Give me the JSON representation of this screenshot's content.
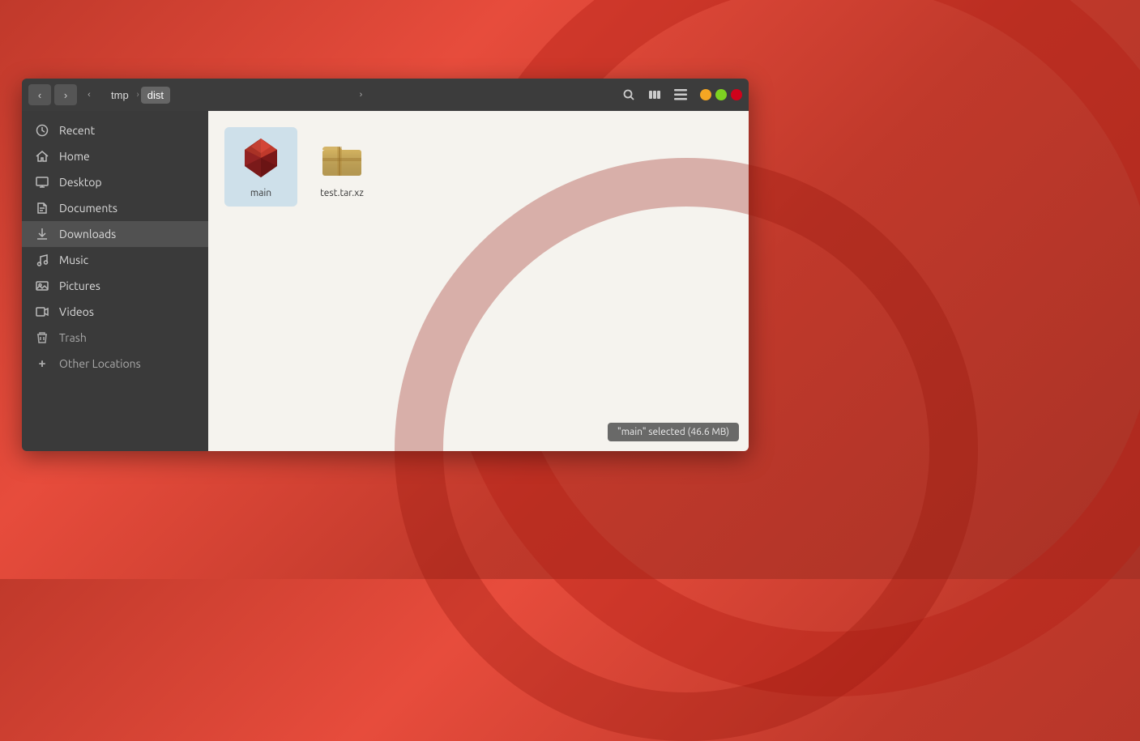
{
  "window": {
    "title": "dist"
  },
  "titlebar": {
    "back_btn": "‹",
    "forward_btn": "›",
    "scroll_left": "‹",
    "scroll_right": "›",
    "breadcrumb": [
      {
        "label": "tmp",
        "active": false
      },
      {
        "label": "dist",
        "active": true
      }
    ],
    "search_tooltip": "Search",
    "view_columns_tooltip": "View columns",
    "view_list_tooltip": "View list",
    "window_controls": {
      "minimize": "–",
      "maximize": "□",
      "close": "×"
    }
  },
  "sidebar": {
    "items": [
      {
        "id": "recent",
        "label": "Recent",
        "icon": "🕐"
      },
      {
        "id": "home",
        "label": "Home",
        "icon": "🏠"
      },
      {
        "id": "desktop",
        "label": "Desktop",
        "icon": "🖥"
      },
      {
        "id": "documents",
        "label": "Documents",
        "icon": "📄"
      },
      {
        "id": "downloads",
        "label": "Downloads",
        "icon": "⬇"
      },
      {
        "id": "music",
        "label": "Music",
        "icon": "🎵"
      },
      {
        "id": "pictures",
        "label": "Pictures",
        "icon": "📷"
      },
      {
        "id": "videos",
        "label": "Videos",
        "icon": "🎬"
      },
      {
        "id": "trash",
        "label": "Trash",
        "icon": "🗑"
      },
      {
        "id": "other-locations",
        "label": "Other Locations",
        "icon": "+"
      }
    ]
  },
  "files": [
    {
      "id": "main",
      "name": "main",
      "type": "executable",
      "selected": true
    },
    {
      "id": "test-tar-xz",
      "name": "test.tar.xz",
      "type": "archive",
      "selected": false
    }
  ],
  "status": {
    "text": "\"main\" selected  (46.6 MB)"
  }
}
